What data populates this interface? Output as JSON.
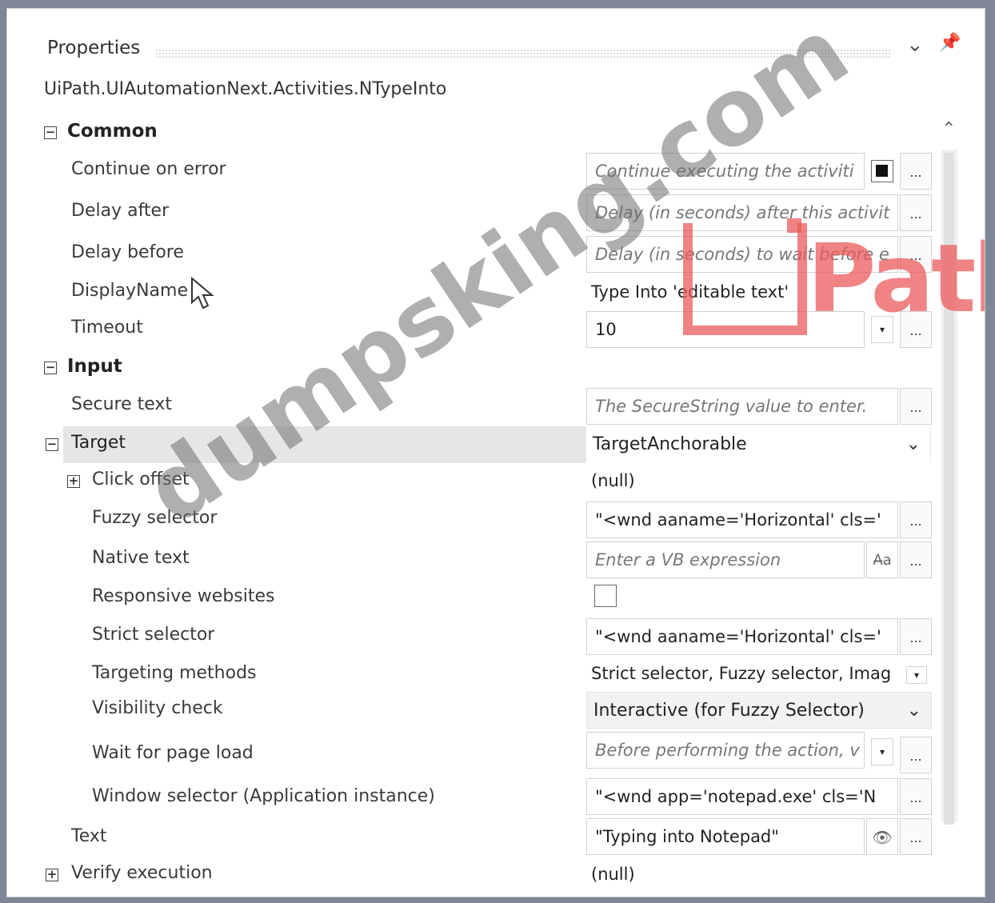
{
  "panel": {
    "title": "Properties",
    "activity_class": "UiPath.UIAutomationNext.Activities.NTypeInto"
  },
  "common": {
    "label": "Common",
    "continue_on_error": {
      "label": "Continue on error",
      "placeholder": "Continue executing the activiti"
    },
    "delay_after": {
      "label": "Delay after",
      "placeholder": "Delay (in seconds) after this activit"
    },
    "delay_before": {
      "label": "Delay before",
      "placeholder": "Delay (in seconds) to wait before e"
    },
    "display_name": {
      "label": "DisplayName",
      "value": "Type Into 'editable text'"
    },
    "timeout": {
      "label": "Timeout",
      "value": "10"
    }
  },
  "input": {
    "label": "Input",
    "secure_text": {
      "label": "Secure text",
      "placeholder": "The SecureString value to enter."
    }
  },
  "target": {
    "label": "Target",
    "value": "TargetAnchorable",
    "click_offset": {
      "label": "Click offset",
      "value": "(null)"
    },
    "fuzzy_selector": {
      "label": "Fuzzy selector",
      "value": "\"<wnd aaname='Horizontal' cls='"
    },
    "native_text": {
      "label": "Native text",
      "placeholder": "Enter a VB expression"
    },
    "responsive_websites": {
      "label": "Responsive websites",
      "checked": false
    },
    "strict_selector": {
      "label": "Strict selector",
      "value": "\"<wnd aaname='Horizontal' cls='"
    },
    "targeting_methods": {
      "label": "Targeting methods",
      "value": "Strict selector, Fuzzy selector, Imag"
    },
    "visibility_check": {
      "label": "Visibility check",
      "value": "Interactive (for Fuzzy Selector)"
    },
    "wait_for_page_load": {
      "label": "Wait for page load",
      "placeholder": "Before performing the action, v"
    },
    "window_selector": {
      "label": "Window selector (Application instance)",
      "value": "\"<wnd app='notepad.exe' cls='N"
    }
  },
  "text": {
    "label": "Text",
    "value": "\"Typing into Notepad\""
  },
  "verify_execution": {
    "label": "Verify execution",
    "value": "(null)"
  },
  "ui": {
    "ellipsis": "...",
    "expand_minus": "−",
    "expand_plus": "+",
    "chevron_down": "⌄",
    "dropdown_arrow": "▾",
    "scroll_up": "︿",
    "pin_icon": "📌"
  },
  "watermarks": {
    "uipath": "Path",
    "dumpsking": "dumpsking.com"
  }
}
